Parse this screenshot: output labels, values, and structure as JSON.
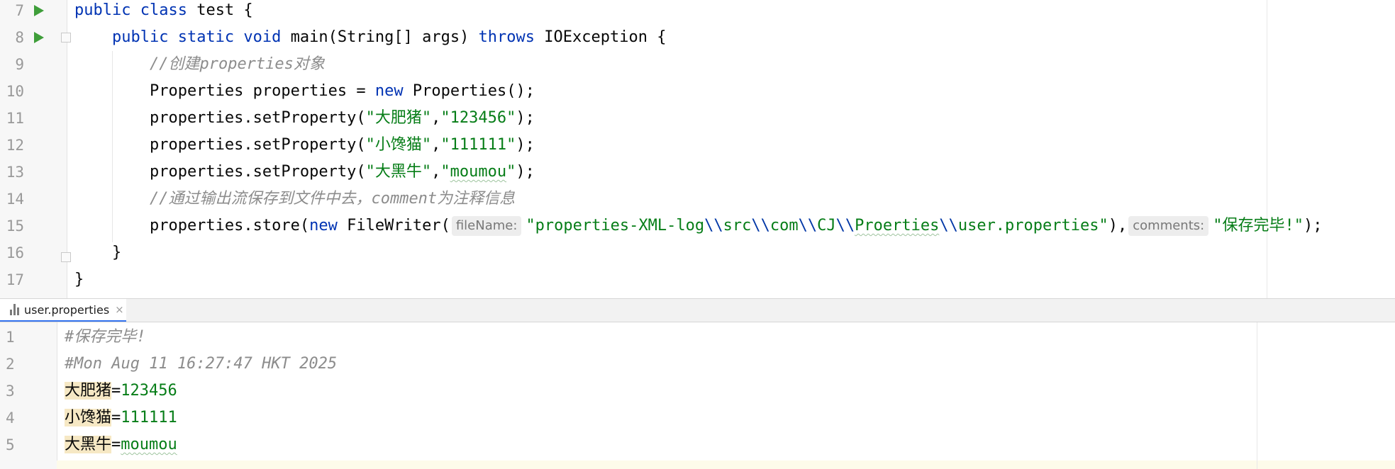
{
  "editor": {
    "lines": [
      {
        "num": "7",
        "tokens": [
          {
            "t": "public class",
            "c": "kw"
          },
          {
            "t": " test {",
            "c": "tx"
          }
        ]
      },
      {
        "num": "8",
        "tokens": [
          {
            "t": "    ",
            "c": "tx"
          },
          {
            "t": "public static void",
            "c": "kw"
          },
          {
            "t": " main",
            "c": "fn"
          },
          {
            "t": "(String[] args) ",
            "c": "tx"
          },
          {
            "t": "throws",
            "c": "kw"
          },
          {
            "t": " IOException {",
            "c": "tx"
          }
        ]
      },
      {
        "num": "9",
        "tokens": [
          {
            "t": "        ",
            "c": "tx"
          },
          {
            "t": "//创建properties对象",
            "c": "cmt"
          }
        ]
      },
      {
        "num": "10",
        "tokens": [
          {
            "t": "        Properties properties = ",
            "c": "tx"
          },
          {
            "t": "new",
            "c": "kw"
          },
          {
            "t": " Properties();",
            "c": "tx"
          }
        ]
      },
      {
        "num": "11",
        "tokens": [
          {
            "t": "        properties.setProperty(",
            "c": "tx"
          },
          {
            "t": "\"大肥猪\"",
            "c": "str"
          },
          {
            "t": ",",
            "c": "tx"
          },
          {
            "t": "\"123456\"",
            "c": "str"
          },
          {
            "t": ");",
            "c": "tx"
          }
        ]
      },
      {
        "num": "12",
        "tokens": [
          {
            "t": "        properties.setProperty(",
            "c": "tx"
          },
          {
            "t": "\"小馋猫\"",
            "c": "str"
          },
          {
            "t": ",",
            "c": "tx"
          },
          {
            "t": "\"111111\"",
            "c": "str"
          },
          {
            "t": ");",
            "c": "tx"
          }
        ]
      },
      {
        "num": "13",
        "tokens": [
          {
            "t": "        properties.setProperty(",
            "c": "tx"
          },
          {
            "t": "\"大黑牛\"",
            "c": "str"
          },
          {
            "t": ",",
            "c": "tx"
          },
          {
            "t": "\"",
            "c": "str"
          },
          {
            "t": "moumou",
            "c": "str-typo"
          },
          {
            "t": "\"",
            "c": "str"
          },
          {
            "t": ");",
            "c": "tx"
          }
        ]
      },
      {
        "num": "14",
        "tokens": [
          {
            "t": "        ",
            "c": "tx"
          },
          {
            "t": "//通过输出流保存到文件中去，comment为注释信息",
            "c": "cmt"
          }
        ]
      },
      {
        "num": "15",
        "tokens": [
          {
            "t": "        properties.store(",
            "c": "tx"
          },
          {
            "t": "new",
            "c": "kw"
          },
          {
            "t": " FileWriter(",
            "c": "tx"
          },
          {
            "t": "fileName:",
            "c": "hint"
          },
          {
            "t": "\"properties-XML-log",
            "c": "str"
          },
          {
            "t": "\\\\",
            "c": "esc"
          },
          {
            "t": "src",
            "c": "str"
          },
          {
            "t": "\\\\",
            "c": "esc"
          },
          {
            "t": "com",
            "c": "str"
          },
          {
            "t": "\\\\",
            "c": "esc"
          },
          {
            "t": "CJ",
            "c": "str"
          },
          {
            "t": "\\\\",
            "c": "esc"
          },
          {
            "t": "Proerties",
            "c": "str-typo"
          },
          {
            "t": "\\\\",
            "c": "esc"
          },
          {
            "t": "user.properties\"",
            "c": "str"
          },
          {
            "t": "),",
            "c": "tx"
          },
          {
            "t": "comments:",
            "c": "hint"
          },
          {
            "t": "\"保存完毕!\"",
            "c": "str"
          },
          {
            "t": ");",
            "c": "tx"
          }
        ]
      },
      {
        "num": "16",
        "tokens": [
          {
            "t": "    }",
            "c": "tx"
          }
        ]
      },
      {
        "num": "17",
        "tokens": [
          {
            "t": "}",
            "c": "tx"
          }
        ]
      }
    ]
  },
  "tab": {
    "label": "user.properties",
    "close": "×",
    "icon": "properties-file-icon"
  },
  "props": {
    "lines": [
      {
        "num": "1",
        "tokens": [
          {
            "t": "#保存完毕!",
            "c": "cmt"
          }
        ]
      },
      {
        "num": "2",
        "tokens": [
          {
            "t": "#Mon Aug 11 16:27:47 HKT 2025",
            "c": "cmt"
          }
        ]
      },
      {
        "num": "3",
        "tokens": [
          {
            "t": "大肥猪",
            "c": "key"
          },
          {
            "t": "=",
            "c": "tx"
          },
          {
            "t": "123456",
            "c": "str"
          }
        ]
      },
      {
        "num": "4",
        "tokens": [
          {
            "t": "小馋猫",
            "c": "key"
          },
          {
            "t": "=",
            "c": "tx"
          },
          {
            "t": "111111",
            "c": "str"
          }
        ]
      },
      {
        "num": "5",
        "tokens": [
          {
            "t": "大黑牛",
            "c": "key"
          },
          {
            "t": "=",
            "c": "tx"
          },
          {
            "t": "moumou",
            "c": "str-typo"
          }
        ]
      }
    ]
  },
  "colors": {
    "keyword": "#0033b3",
    "string": "#067d17",
    "comment": "#8c8c8c",
    "run": "#3f9e3a",
    "tab_accent": "#3574f0",
    "key_highlight": "#f6e8c4"
  }
}
